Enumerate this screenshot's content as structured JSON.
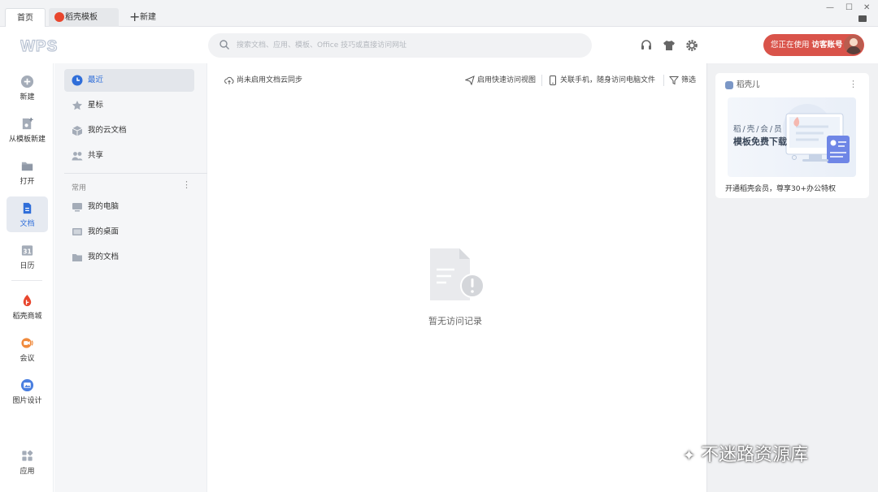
{
  "tabs": [
    {
      "label": "首页"
    },
    {
      "label": "稻壳模板"
    },
    {
      "label": "新建"
    }
  ],
  "window_controls": {
    "minimize": "—",
    "maximize": "☐",
    "close": "✕"
  },
  "header": {
    "logo": "WPS",
    "search_placeholder": "搜索文档、应用、模板、Office 技巧或直接访问网址",
    "account_prefix": "您正在使用",
    "account_name": "访客账号"
  },
  "rail": [
    {
      "label": "新建",
      "icon": "plus-circle-icon"
    },
    {
      "label": "从模板新建",
      "icon": "template-icon"
    },
    {
      "label": "打开",
      "icon": "folder-icon"
    },
    {
      "label": "文档",
      "icon": "document-icon",
      "active": true
    },
    {
      "label": "日历",
      "icon": "calendar-icon"
    },
    {
      "label": "稻壳商城",
      "icon": "docer-icon"
    },
    {
      "label": "会议",
      "icon": "meeting-icon"
    },
    {
      "label": "图片设计",
      "icon": "image-design-icon"
    },
    {
      "label": "应用",
      "icon": "apps-icon"
    }
  ],
  "calendar_day": "31",
  "nav": {
    "items": [
      {
        "label": "最近",
        "active": true
      },
      {
        "label": "星标"
      },
      {
        "label": "我的云文档"
      },
      {
        "label": "共享"
      }
    ],
    "section_label": "常用",
    "section_more": "⋮",
    "common": [
      {
        "label": "我的电脑"
      },
      {
        "label": "我的桌面"
      },
      {
        "label": "我的文档"
      }
    ]
  },
  "main": {
    "sync_status": "尚未启用文档云同步",
    "quick_view": "启用快速访问视图",
    "link_phone": "关联手机，随身访问电脑文件",
    "filter": "筛选",
    "empty_text": "暂无访问记录"
  },
  "right_card": {
    "title": "稻壳儿",
    "more": "⋮",
    "banner_line1": "稻/壳/会/员",
    "banner_line2": "模板免费下载",
    "desc": "开通稻壳会员，尊享30+办公特权"
  },
  "watermark": "不迷路资源库",
  "colors": {
    "accent": "#2f6ed9",
    "account_bg": "#d9534a",
    "docer_red": "#e8462d"
  }
}
